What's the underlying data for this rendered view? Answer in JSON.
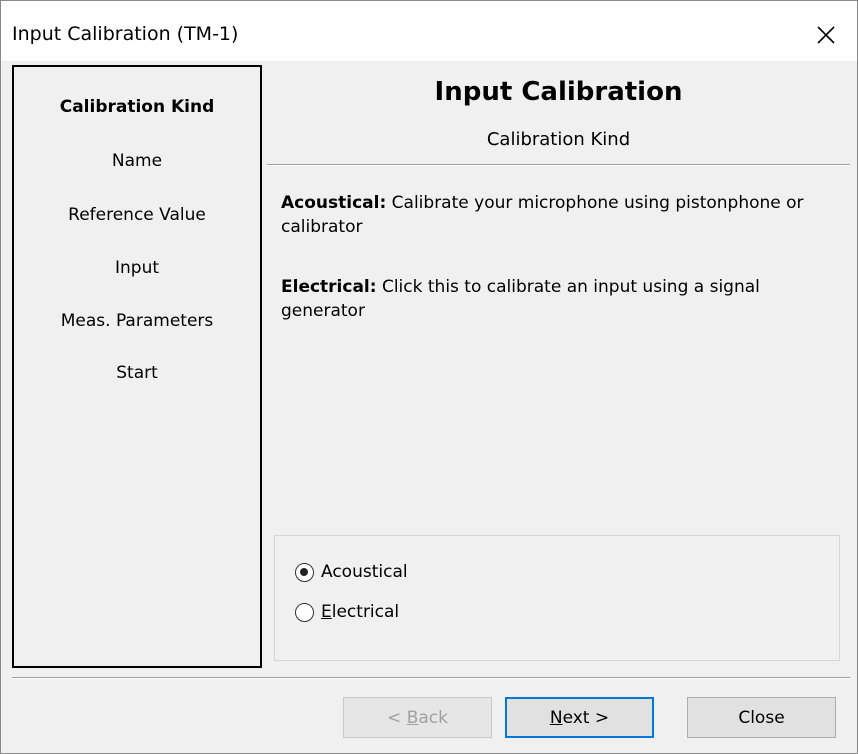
{
  "window": {
    "title": "Input Calibration (TM-1)",
    "close_glyph": "✕"
  },
  "sidebar": {
    "steps": [
      {
        "label": "Calibration Kind",
        "active": true
      },
      {
        "label": "Name",
        "active": false
      },
      {
        "label": "Reference Value",
        "active": false
      },
      {
        "label": "Input",
        "active": false
      },
      {
        "label": "Meas. Parameters",
        "active": false
      },
      {
        "label": "Start",
        "active": false
      }
    ]
  },
  "header": {
    "title": "Input Calibration",
    "subtitle": "Calibration Kind"
  },
  "descriptions": {
    "acoustical_label": "Acoustical:",
    "acoustical_text": " Calibrate your microphone using pistonphone or calibrator",
    "electrical_label": "Electrical:",
    "electrical_text": " Click this to calibrate an input using a signal generator"
  },
  "options": {
    "acoustical": {
      "label": "Acoustical",
      "checked": true
    },
    "electrical": {
      "label_prefix": "",
      "label_accel": "E",
      "label_rest": "lectrical",
      "checked": false
    }
  },
  "buttons": {
    "back": {
      "prefix": "< ",
      "accel": "B",
      "rest": "ack",
      "enabled": false
    },
    "next": {
      "accel": "N",
      "rest": "ext >",
      "enabled": true
    },
    "close": {
      "label": "Close",
      "enabled": true
    }
  },
  "colors": {
    "window_bg": "#f0f0f0",
    "titlebar_bg": "#ffffff",
    "default_button_border": "#0078d7",
    "disabled_text": "#a0a0a0"
  }
}
